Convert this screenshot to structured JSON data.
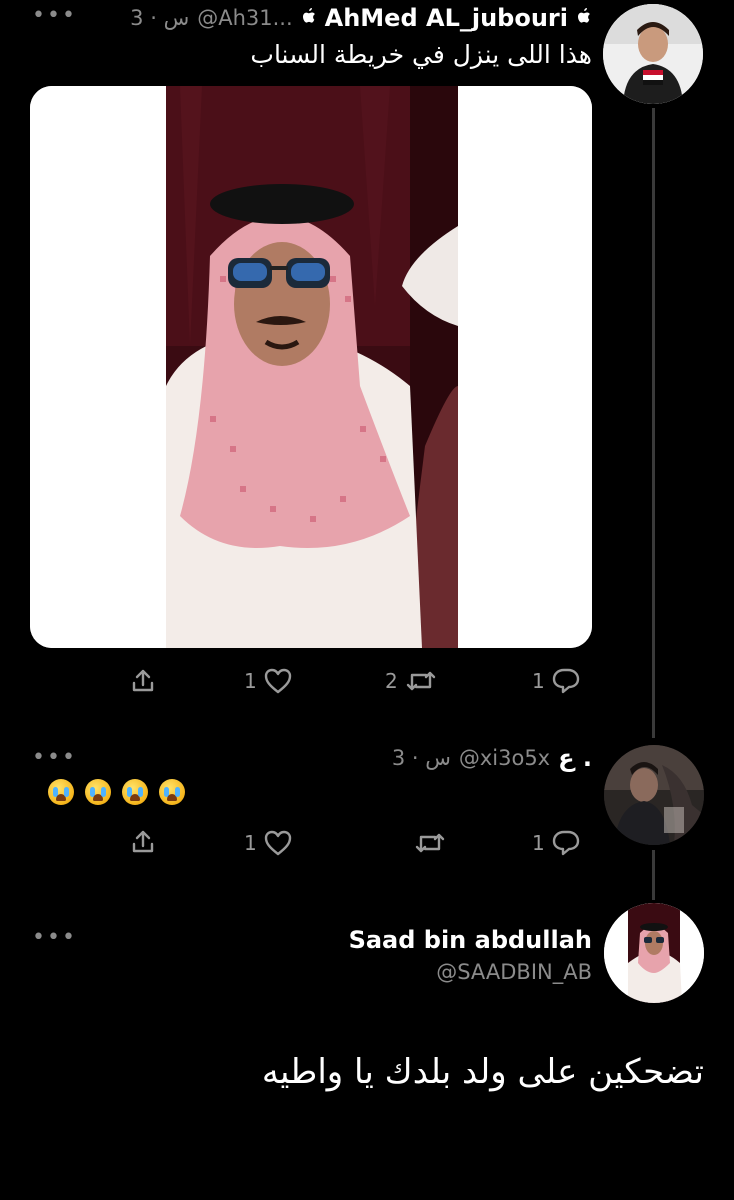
{
  "tweet1": {
    "name": "AhMed AL_jubouri",
    "handle": "@Ah31...",
    "time": "3 · س",
    "text": "هذا اللى ينزل في خريطة السناب",
    "more": "•••",
    "actions": {
      "share_count": "",
      "like_count": "1",
      "retweet_count": "2",
      "reply_count": "1"
    }
  },
  "tweet2": {
    "name": "ع .",
    "handle": "@xi3o5x",
    "time": "3 · س",
    "more": "•••",
    "emoji_text": "😭😭😭😭",
    "actions": {
      "like_count": "1",
      "retweet_count": "",
      "reply_count": "1"
    }
  },
  "tweet3": {
    "name": "Saad bin abdullah",
    "handle": "@SAADBIN_AB",
    "more": "•••",
    "text": "تضحكين على ولد بلدك يا واطيه"
  },
  "icons": {
    "share": "share-icon",
    "like": "heart-icon",
    "retweet": "retweet-icon",
    "reply": "reply-icon",
    "apple": "apple-icon"
  },
  "colors": {
    "background": "#000000",
    "meta": "#8b8b8b",
    "line": "#3a3a3a"
  }
}
